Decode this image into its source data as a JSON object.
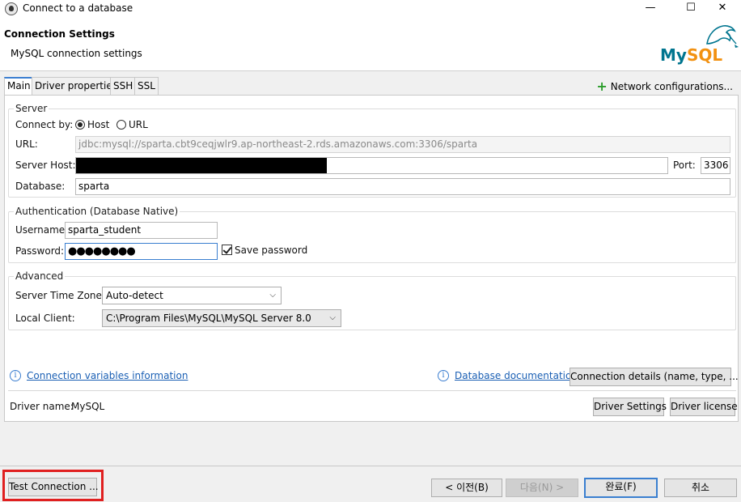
{
  "window": {
    "title": "Connect to a database",
    "minimize": "—",
    "maximize": "☐",
    "close": "✕"
  },
  "header": {
    "title": "Connection Settings",
    "subtitle": "MySQL connection settings",
    "logo_text_my": "My",
    "logo_text_sql": "SQL"
  },
  "tabs": [
    {
      "label": "Main"
    },
    {
      "label": "Driver properties"
    },
    {
      "label": "SSH"
    },
    {
      "label": "SSL"
    }
  ],
  "network_configurations": "Network configurations...",
  "server": {
    "group_title": "Server",
    "connect_by_label": "Connect by:",
    "host_option": "Host",
    "url_option": "URL",
    "url_label": "URL:",
    "url_value": "jdbc:mysql://sparta.cbt9ceqjwlr9.ap-northeast-2.rds.amazonaws.com:3306/sparta",
    "server_host_label": "Server Host:",
    "port_label": "Port:",
    "port_value": "3306",
    "database_label": "Database:",
    "database_value": "sparta"
  },
  "auth": {
    "group_title": "Authentication (Database Native)",
    "username_label": "Username:",
    "username_value": "sparta_student",
    "password_label": "Password:",
    "password_value": "●●●●●●●●",
    "save_password": "Save password"
  },
  "advanced": {
    "group_title": "Advanced",
    "timezone_label": "Server Time Zone:",
    "timezone_value": "Auto-detect",
    "local_client_label": "Local Client:",
    "local_client_value": "C:\\Program Files\\MySQL\\MySQL Server 8.0"
  },
  "links": {
    "conn_vars": "Connection variables information",
    "db_docs": "Database documentation",
    "conn_details": "Connection details (name, type, ... )"
  },
  "driver": {
    "name_label": "Driver name:",
    "name_value": "MySQL",
    "settings": "Driver Settings",
    "license": "Driver license"
  },
  "footer": {
    "test_connection": "Test Connection ...",
    "back": "< 이전(B)",
    "next": "다음(N) >",
    "finish": "완료(F)",
    "cancel": "취소"
  },
  "colors": {
    "accent": "#3a7fd0",
    "link": "#1a5fb4",
    "highlight": "#e02020",
    "mysql_blue": "#00758f",
    "mysql_orange": "#f29111"
  }
}
